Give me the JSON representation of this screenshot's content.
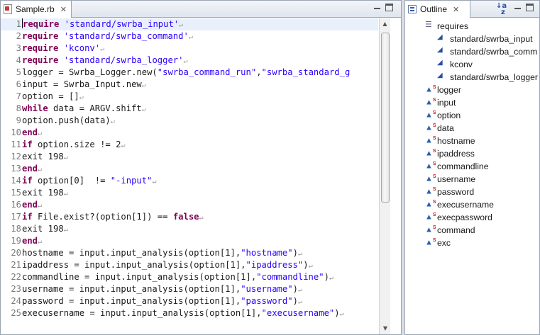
{
  "editor": {
    "tab_label": "Sample.rb",
    "close_glyph": "✕",
    "eol_glyph": "↵",
    "lines": [
      [
        [
          "kw",
          "require"
        ],
        [
          "t",
          " "
        ],
        [
          "str",
          "'standard/swrba_input'"
        ]
      ],
      [
        [
          "kw",
          "require"
        ],
        [
          "t",
          " "
        ],
        [
          "str",
          "'standard/swrba_command'"
        ]
      ],
      [
        [
          "kw",
          "require"
        ],
        [
          "t",
          " "
        ],
        [
          "str",
          "'kconv'"
        ]
      ],
      [
        [
          "kw",
          "require"
        ],
        [
          "t",
          " "
        ],
        [
          "str",
          "'standard/swrba_logger'"
        ]
      ],
      [
        [
          "t",
          "logger = Swrba_Logger.new("
        ],
        [
          "str",
          "\"swrba_command_run\""
        ],
        [
          "t",
          ","
        ],
        [
          "str",
          "\"swrba_standard_g"
        ]
      ],
      [
        [
          "t",
          "input = Swrba_Input.new"
        ]
      ],
      [
        [
          "t",
          "option = []"
        ]
      ],
      [
        [
          "kw",
          "while"
        ],
        [
          "t",
          " data = ARGV.shift"
        ]
      ],
      [
        [
          "t",
          "option.push(data)"
        ]
      ],
      [
        [
          "kw",
          "end"
        ]
      ],
      [
        [
          "kw",
          "if"
        ],
        [
          "t",
          " option.size != 2"
        ]
      ],
      [
        [
          "t",
          "exit 198"
        ]
      ],
      [
        [
          "kw",
          "end"
        ]
      ],
      [
        [
          "kw",
          "if"
        ],
        [
          "t",
          " option[0]  != "
        ],
        [
          "str",
          "\"-input\""
        ]
      ],
      [
        [
          "t",
          "exit 198"
        ]
      ],
      [
        [
          "kw",
          "end"
        ]
      ],
      [
        [
          "kw",
          "if"
        ],
        [
          "t",
          " File.exist?(option[1]) == "
        ],
        [
          "kw",
          "false"
        ]
      ],
      [
        [
          "t",
          "exit 198"
        ]
      ],
      [
        [
          "kw",
          "end"
        ]
      ],
      [
        [
          "t",
          "hostname = input.input_analysis(option[1],"
        ],
        [
          "str",
          "\"hostname\""
        ],
        [
          "t",
          ")"
        ]
      ],
      [
        [
          "t",
          "ipaddress = input.input_analysis(option[1],"
        ],
        [
          "str",
          "\"ipaddress\""
        ],
        [
          "t",
          ")"
        ]
      ],
      [
        [
          "t",
          "commandline = input.input_analysis(option[1],"
        ],
        [
          "str",
          "\"commandline\""
        ],
        [
          "t",
          ")"
        ]
      ],
      [
        [
          "t",
          "username = input.input_analysis(option[1],"
        ],
        [
          "str",
          "\"username\""
        ],
        [
          "t",
          ")"
        ]
      ],
      [
        [
          "t",
          "password = input.input_analysis(option[1],"
        ],
        [
          "str",
          "\"password\""
        ],
        [
          "t",
          ")"
        ]
      ],
      [
        [
          "t",
          "execusername = input.input_analysis(option[1],"
        ],
        [
          "str",
          "\"execusername\""
        ],
        [
          "t",
          ")"
        ]
      ]
    ],
    "no_eol_lines": [
      5
    ]
  },
  "outline": {
    "tab_label": "Outline",
    "close_glyph": "✕",
    "sort_glyph": "↓a z",
    "requires_label": "requires",
    "requires_children": [
      "standard/swrba_input",
      "standard/swrba_comm",
      "kconv",
      "standard/swrba_logger"
    ],
    "variables": [
      "logger",
      "input",
      "option",
      "data",
      "hostname",
      "ipaddress",
      "commandline",
      "username",
      "password",
      "execusername",
      "execpassword",
      "command",
      "exc"
    ]
  },
  "colors": {
    "keyword": "#7f0055",
    "string": "#2a00ff",
    "current_line": "#e8f0fc"
  }
}
